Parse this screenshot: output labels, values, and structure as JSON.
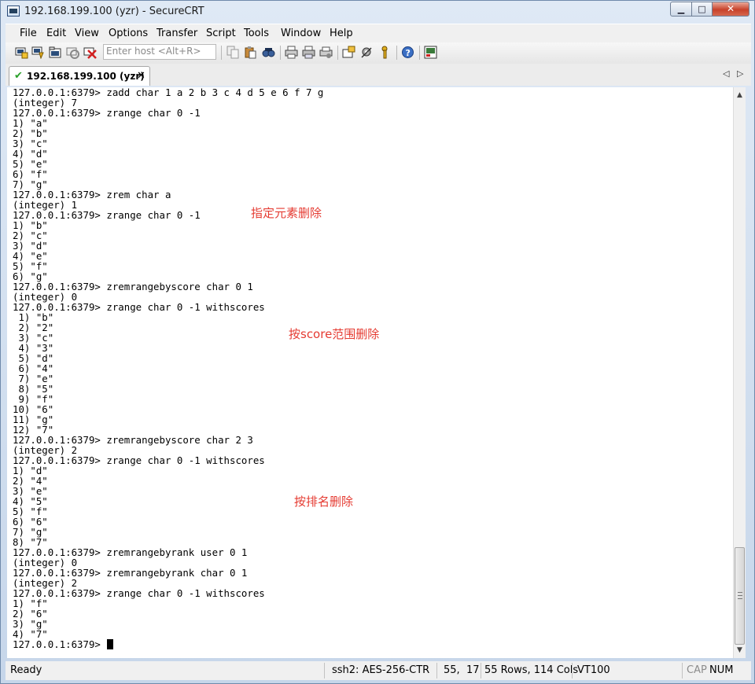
{
  "window": {
    "title": "192.168.199.100 (yzr) - SecureCRT",
    "controls": {
      "minimize": "▁",
      "maximize": "□",
      "close": "✕"
    }
  },
  "menu": [
    "File",
    "Edit",
    "View",
    "Options",
    "Transfer",
    "Script",
    "Tools",
    "Window",
    "Help"
  ],
  "toolbar": {
    "host_placeholder": "Enter host <Alt+R>",
    "icons": [
      "connect-icon",
      "quick-connect-icon",
      "connect-in-tab-icon",
      "reconnect-icon",
      "disconnect-icon",
      "copy-icon",
      "paste-icon",
      "find-icon",
      "print-icon",
      "print-selection-icon",
      "print-setup-icon",
      "session-options-icon",
      "global-options-icon",
      "keymap-icon",
      "help-icon",
      "about-icon"
    ]
  },
  "tab": {
    "label": "192.168.199.100 (yzr)",
    "close": "✕",
    "prev": "◁",
    "next": "▷"
  },
  "terminal": {
    "lines": [
      "127.0.0.1:6379> zadd char 1 a 2 b 3 c 4 d 5 e 6 f 7 g",
      "(integer) 7",
      "127.0.0.1:6379> zrange char 0 -1",
      "1) \"a\"",
      "2) \"b\"",
      "3) \"c\"",
      "4) \"d\"",
      "5) \"e\"",
      "6) \"f\"",
      "7) \"g\"",
      "127.0.0.1:6379> zrem char a",
      "(integer) 1",
      "127.0.0.1:6379> zrange char 0 -1",
      "1) \"b\"",
      "2) \"c\"",
      "3) \"d\"",
      "4) \"e\"",
      "5) \"f\"",
      "6) \"g\"",
      "127.0.0.1:6379> zremrangebyscore char 0 1",
      "(integer) 0",
      "127.0.0.1:6379> zrange char 0 -1 withscores",
      " 1) \"b\"",
      " 2) \"2\"",
      " 3) \"c\"",
      " 4) \"3\"",
      " 5) \"d\"",
      " 6) \"4\"",
      " 7) \"e\"",
      " 8) \"5\"",
      " 9) \"f\"",
      "10) \"6\"",
      "11) \"g\"",
      "12) \"7\"",
      "127.0.0.1:6379> zremrangebyscore char 2 3",
      "(integer) 2",
      "127.0.0.1:6379> zrange char 0 -1 withscores",
      "1) \"d\"",
      "2) \"4\"",
      "3) \"e\"",
      "4) \"5\"",
      "5) \"f\"",
      "6) \"6\"",
      "7) \"g\"",
      "8) \"7\"",
      "127.0.0.1:6379> zremrangebyrank user 0 1",
      "(integer) 0",
      "127.0.0.1:6379> zremrangebyrank char 0 1",
      "(integer) 2",
      "127.0.0.1:6379> zrange char 0 -1 withscores",
      "1) \"f\"",
      "2) \"6\"",
      "3) \"g\"",
      "4) \"7\""
    ],
    "prompt": "127.0.0.1:6379> ",
    "annotations": [
      "指定元素删除",
      "按score范围删除",
      "按排名删除"
    ]
  },
  "status": {
    "ready": "Ready",
    "cipher": "ssh2: AES-256-CTR",
    "cursor_pos": "55,  17",
    "dims": "55 Rows, 114 Cols",
    "emulation": "VT100",
    "cap": "CAP",
    "num": "NUM"
  },
  "colors": {
    "annotation": "#e53b32",
    "terminal_bg": "#ffffff",
    "terminal_fg": "#000000"
  }
}
